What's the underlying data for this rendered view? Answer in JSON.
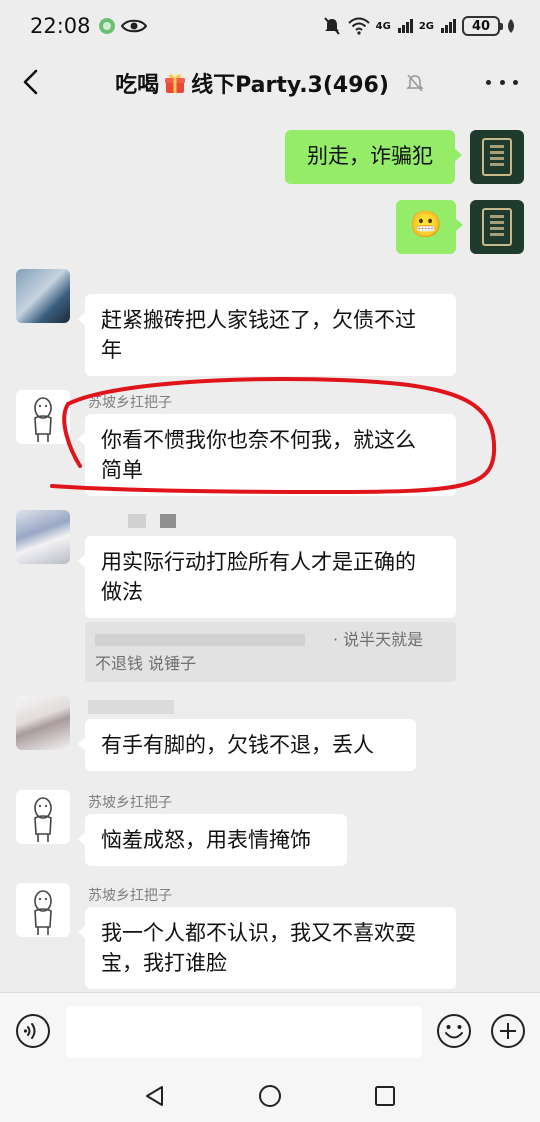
{
  "status_bar": {
    "time": "22:08",
    "network_labels": [
      "4G",
      "2G"
    ],
    "battery": "40"
  },
  "header": {
    "title_prefix": "吃喝",
    "title_suffix": "线下Party.3(496)",
    "gift_icon": "gift-icon",
    "muted_icon": "bell-off-icon",
    "more_icon": "more-dots-icon"
  },
  "messages": [
    {
      "id": "m1",
      "direction": "out",
      "text": "别走，诈骗犯"
    },
    {
      "id": "m2",
      "direction": "out",
      "text": "😬"
    },
    {
      "id": "m3",
      "direction": "in",
      "sender": "",
      "text_lines": [
        "赶紧搬砖把人家钱还了，欠债不过",
        "年"
      ]
    },
    {
      "id": "m4",
      "direction": "in",
      "sender": "苏坡乡扛把子",
      "text_lines": [
        "你看不惯我你也奈不何我，就这么",
        "简单"
      ]
    },
    {
      "id": "m5",
      "direction": "in",
      "sender": "",
      "text_lines": [
        "用实际行动打脸所有人才是正确的",
        "做法"
      ],
      "quote_lines": [
        "· 说半天就是",
        "不退钱 说锤子"
      ]
    },
    {
      "id": "m6",
      "direction": "in",
      "sender": "",
      "text_lines": [
        "有手有脚的，欠钱不退，丢人"
      ]
    },
    {
      "id": "m7",
      "direction": "in",
      "sender": "苏坡乡扛把子",
      "text_lines": [
        "恼羞成怒，用表情掩饰"
      ]
    },
    {
      "id": "m8",
      "direction": "in",
      "sender": "苏坡乡扛把子",
      "text_lines": [
        "我一个人都不认识，我又不喜欢耍",
        "宝，我打谁脸"
      ]
    }
  ],
  "input_bar": {
    "voice_icon": "voice-icon",
    "emoji_icon": "emoji-icon",
    "plus_icon": "plus-icon",
    "input_value": ""
  },
  "colors": {
    "outgoing_bubble": "#95ec69",
    "incoming_bubble": "#ffffff",
    "background": "#ededed",
    "annotation": "#e0141b"
  }
}
